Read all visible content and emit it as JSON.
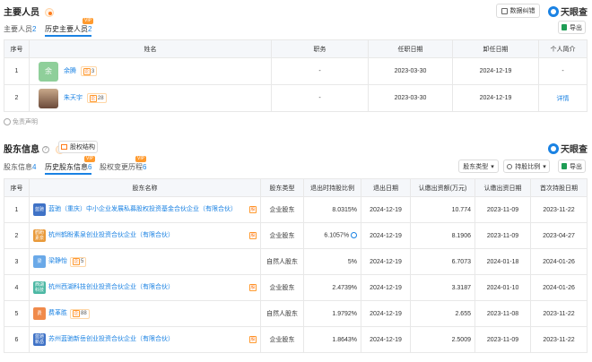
{
  "main_staff": {
    "title": "主要人员",
    "data_btn": "数据纠错",
    "brand": "天眼查",
    "export": "导出",
    "tabs": [
      {
        "label": "主要人员",
        "count": "2"
      },
      {
        "label": "历史主要人员",
        "count": "2",
        "vip": "VIP"
      }
    ],
    "headers": [
      "序号",
      "姓名",
      "职务",
      "任职日期",
      "卸任日期",
      "个人简介"
    ],
    "rows": [
      {
        "idx": "1",
        "avatar": "余",
        "name": "余腾",
        "badge": "3",
        "role": "-",
        "start": "2023-03-30",
        "end": "2024-12-19",
        "intro": "-"
      },
      {
        "idx": "2",
        "avatar": "",
        "name": "朱天宇",
        "badge": "28",
        "role": "-",
        "start": "2023-03-30",
        "end": "2024-12-19",
        "intro": "详情"
      }
    ],
    "disclaimer": "免责声明"
  },
  "shareholders": {
    "title": "股东信息",
    "structure_btn": "股权结构",
    "brand": "天眼查",
    "tabs": [
      {
        "label": "股东信息",
        "count": "4"
      },
      {
        "label": "历史股东信息",
        "count": "6",
        "vip": "VIP"
      },
      {
        "label": "股权变更历程",
        "count": "6",
        "vip": "VIP"
      }
    ],
    "filter1": "股东类型",
    "filter2": "持股比例",
    "export": "导出",
    "headers": [
      "序号",
      "股东名称",
      "股东类型",
      "退出时持股比例",
      "退出日期",
      "认缴出资额(万元)",
      "认缴出资日期",
      "首次持股日期"
    ],
    "rows": [
      {
        "idx": "1",
        "logo": "蓝驰",
        "logo_color": "#3f72c6",
        "name": "蓝驰（重庆）中小企业发展私募股权投资基金合伙企业（有限合伙）",
        "badge": "",
        "type": "企业股东",
        "ratio": "8.0315%",
        "exit": "2024-12-19",
        "amount": "10.774",
        "sub_date": "2023-11-09",
        "first": "2023-11-22"
      },
      {
        "idx": "2",
        "logo": "鹤盼 素泉",
        "logo_color": "#e99a3a",
        "name": "杭州鹤盼素泉创业投资合伙企业（有限合伙）",
        "badge": "",
        "type": "企业股东",
        "ratio": "6.1057%",
        "exit": "2024-12-19",
        "amount": "8.1906",
        "sub_date": "2023-11-09",
        "first": "2023-04-27"
      },
      {
        "idx": "3",
        "logo": "梁",
        "logo_color": "#6aa9e8",
        "name": "梁静怡",
        "badge": "5",
        "type": "自然人股东",
        "ratio": "5%",
        "exit": "2024-12-19",
        "amount": "6.7073",
        "sub_date": "2024-01-18",
        "first": "2024-01-26"
      },
      {
        "idx": "4",
        "logo": "西湖 科技",
        "logo_color": "#4cb8a4",
        "name": "杭州西湖科技创业投资合伙企业（有限合伙）",
        "badge": "",
        "type": "企业股东",
        "ratio": "2.4739%",
        "exit": "2024-12-19",
        "amount": "3.3187",
        "sub_date": "2024-01-10",
        "first": "2024-01-26"
      },
      {
        "idx": "5",
        "logo": "费",
        "logo_color": "#f08a4b",
        "name": "费革胜",
        "badge": "88",
        "type": "自然人股东",
        "ratio": "1.9792%",
        "exit": "2024-12-19",
        "amount": "2.655",
        "sub_date": "2023-11-08",
        "first": "2023-11-22"
      },
      {
        "idx": "6",
        "logo": "蓝驰 新岳",
        "logo_color": "#3f72c6",
        "name": "苏州蓝驰新岳创业投资合伙企业（有限合伙）",
        "badge": "",
        "type": "企业股东",
        "ratio": "1.8643%",
        "exit": "2024-12-19",
        "amount": "2.5009",
        "sub_date": "2023-11-09",
        "first": "2023-11-22"
      }
    ]
  }
}
